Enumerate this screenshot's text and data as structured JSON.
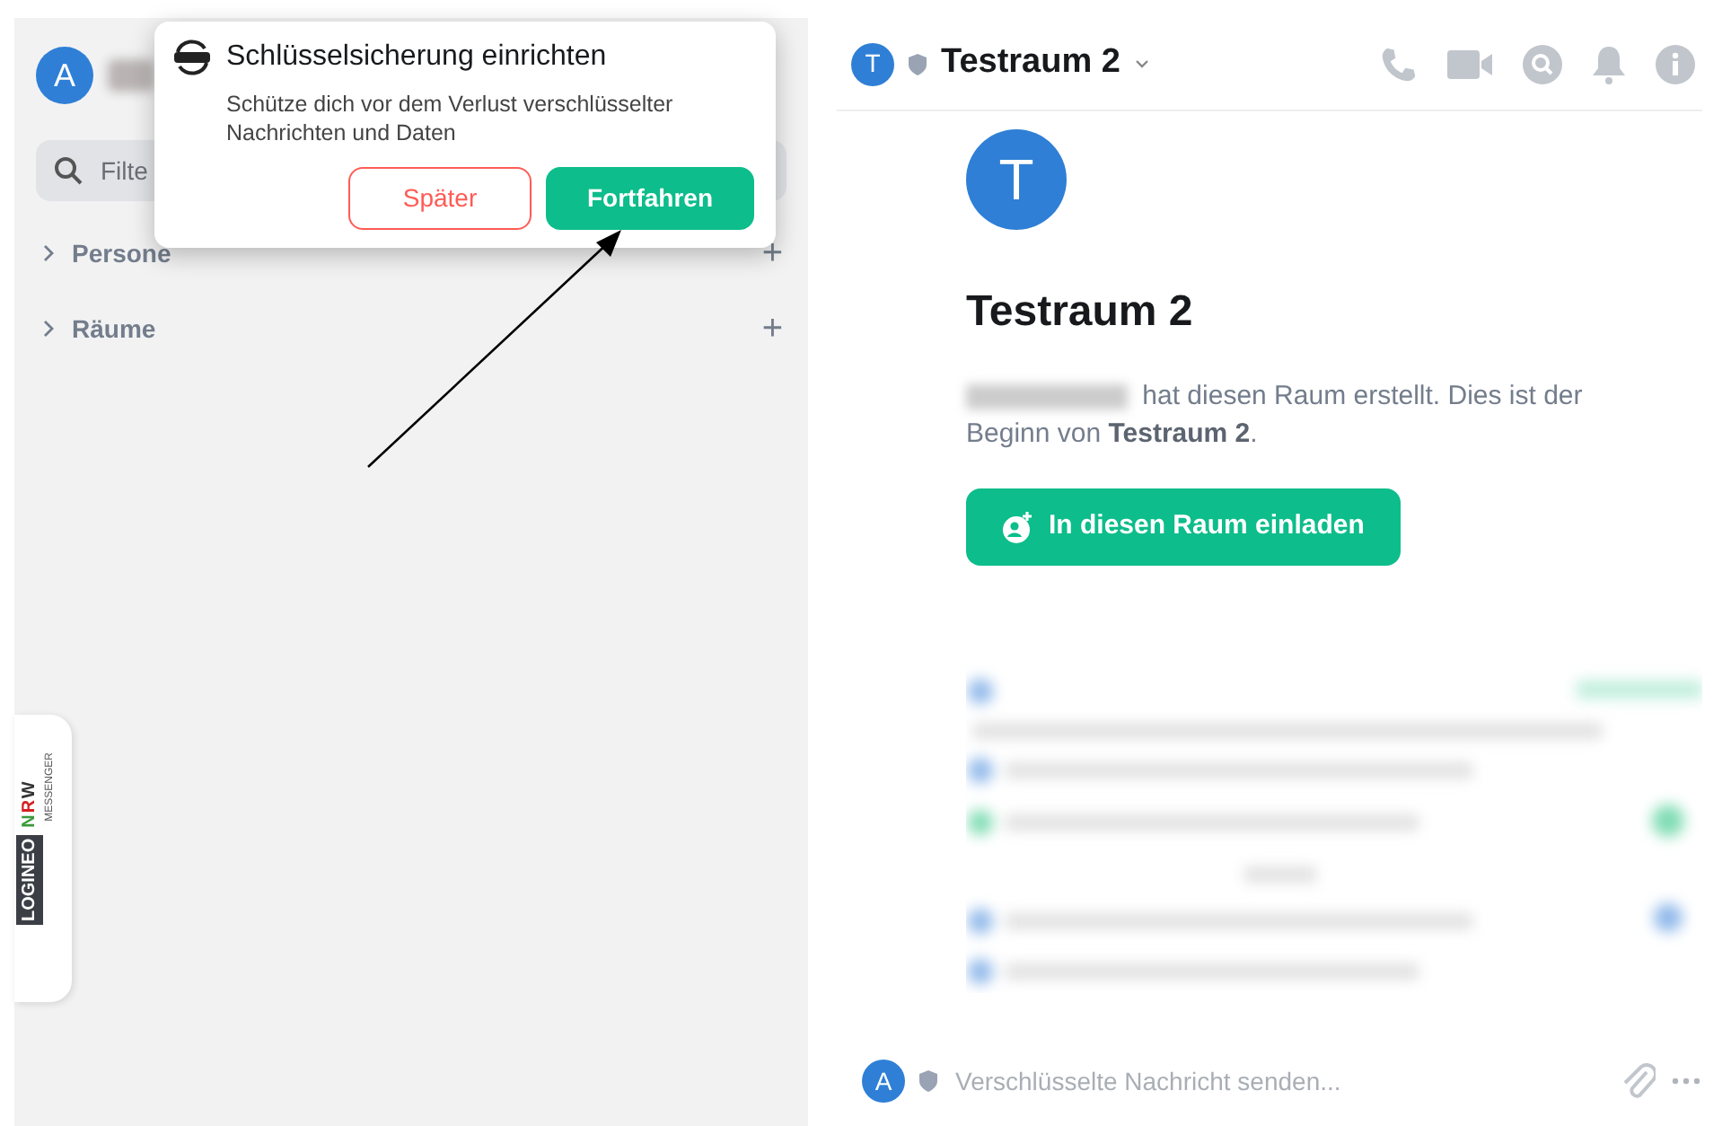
{
  "user": {
    "avatar": "A"
  },
  "popup": {
    "title": "Schlüsselsicherung einrichten",
    "text": "Schütze dich vor dem Verlust verschlüsselter Nachrichten und Daten",
    "buttons": [
      {
        "label": "Später",
        "kind": "secondary"
      },
      {
        "label": "Fortfahren",
        "kind": "primary"
      }
    ]
  },
  "filter": {
    "placeholder": "Filte"
  },
  "sections": [
    {
      "label": "Persone",
      "expanded": false,
      "add": "+"
    },
    {
      "label": "Räume",
      "expanded": false,
      "add": "+"
    }
  ],
  "logo": {
    "text": "LOGINEO",
    "accent": "NRW",
    "sub": "MESSENGER"
  },
  "room": {
    "avatar": "T",
    "big_avatar": "T",
    "name": "Testraum 2",
    "heading": "Testraum 2",
    "created": "hat diesen Raum erstellt. Dies ist der Beginn von **Testraum 2**.",
    "invite": "In diesen Raum einladen"
  },
  "composer": {
    "avatar": "A",
    "placeholder": "Verschlüsselte Nachricht senden..."
  }
}
